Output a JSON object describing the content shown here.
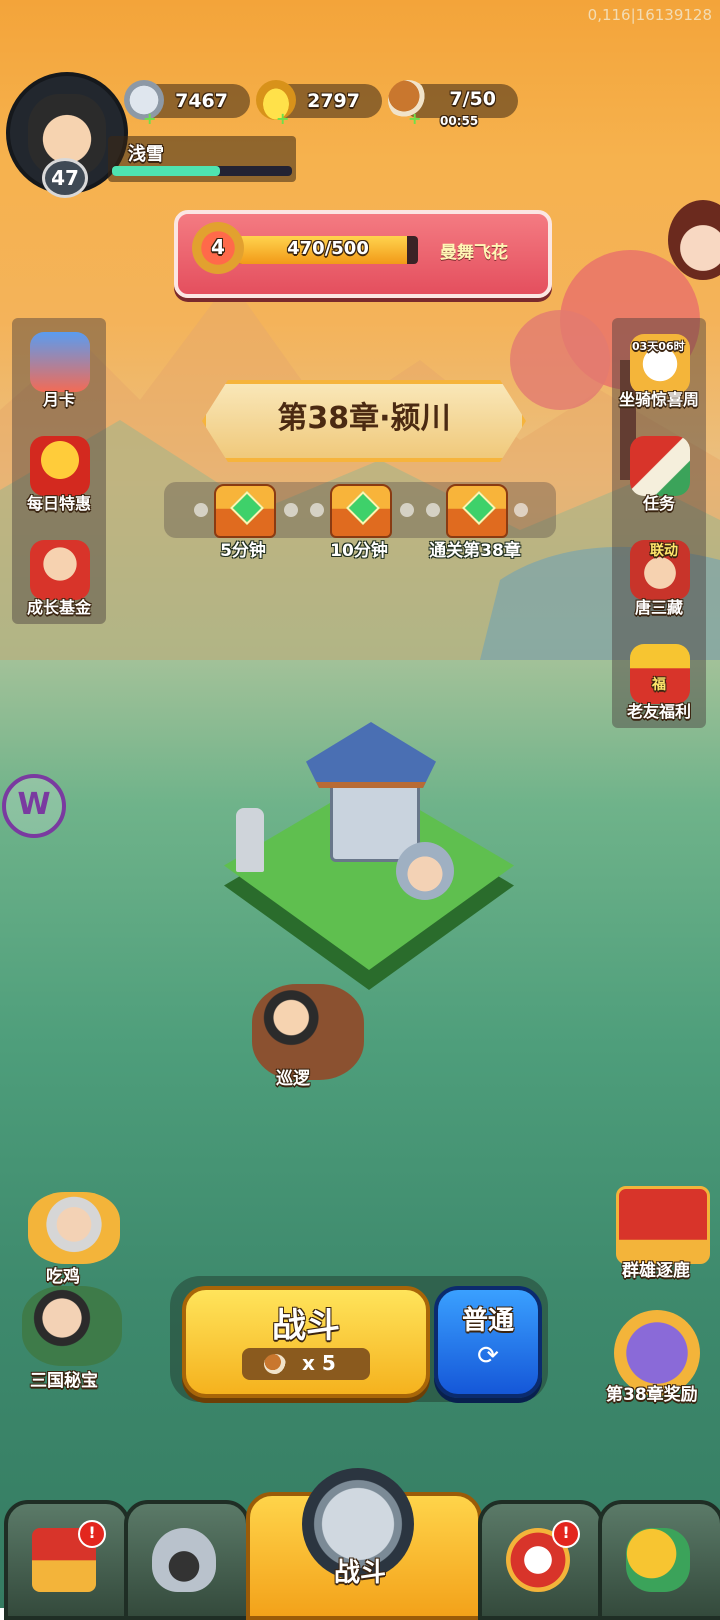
{
  "debug_text": "0,116|16139128",
  "player": {
    "level": "47",
    "name": "浅雪",
    "exp_fraction": 0.6
  },
  "resources": {
    "silver": {
      "value": "7467",
      "icon": "coin-icon"
    },
    "gold": {
      "value": "2797",
      "icon": "gold-ingot-icon"
    },
    "stamina": {
      "value": "7/50",
      "timer": "00:55",
      "icon": "meat-icon"
    }
  },
  "quest": {
    "rank": "4",
    "progress_text": "470/500",
    "progress_fraction": 0.94,
    "title": "曼舞飞花"
  },
  "left_menu": [
    {
      "label": "月卡",
      "icon": "calendar-card-icon"
    },
    {
      "label": "每日特惠",
      "icon": "gift-bag-icon"
    },
    {
      "label": "成长基金",
      "icon": "fortune-god-icon"
    }
  ],
  "right_menu": [
    {
      "label": "坐骑惊喜周",
      "timer": "03天06时",
      "icon": "mount-icon"
    },
    {
      "label": "任务",
      "icon": "scroll-icon"
    },
    {
      "label": "唐三藏",
      "tag": "联动",
      "icon": "monk-icon"
    },
    {
      "label": "老友福利",
      "tag": "福",
      "icon": "treasure-chest-icon"
    }
  ],
  "chapter": {
    "title": "第38章·颍川"
  },
  "chests": [
    {
      "label": "5分钟"
    },
    {
      "label": "10分钟"
    },
    {
      "label": "通关第38章"
    }
  ],
  "patrol": {
    "label": "巡逻"
  },
  "left_bottom": [
    {
      "label": "吃鸡",
      "icon": "chicken-hero-icon"
    },
    {
      "label": "三国秘宝",
      "icon": "treasure-hero-icon"
    }
  ],
  "right_bottom": [
    {
      "label": "群雄逐鹿",
      "icon": "banner-icon"
    },
    {
      "label": "第38章奖励",
      "icon": "chapter-reward-icon"
    }
  ],
  "battle": {
    "fight_label": "战斗",
    "cost": "x 5",
    "mode_label": "普通"
  },
  "nav": {
    "active_label": "战斗",
    "badge": "!"
  }
}
